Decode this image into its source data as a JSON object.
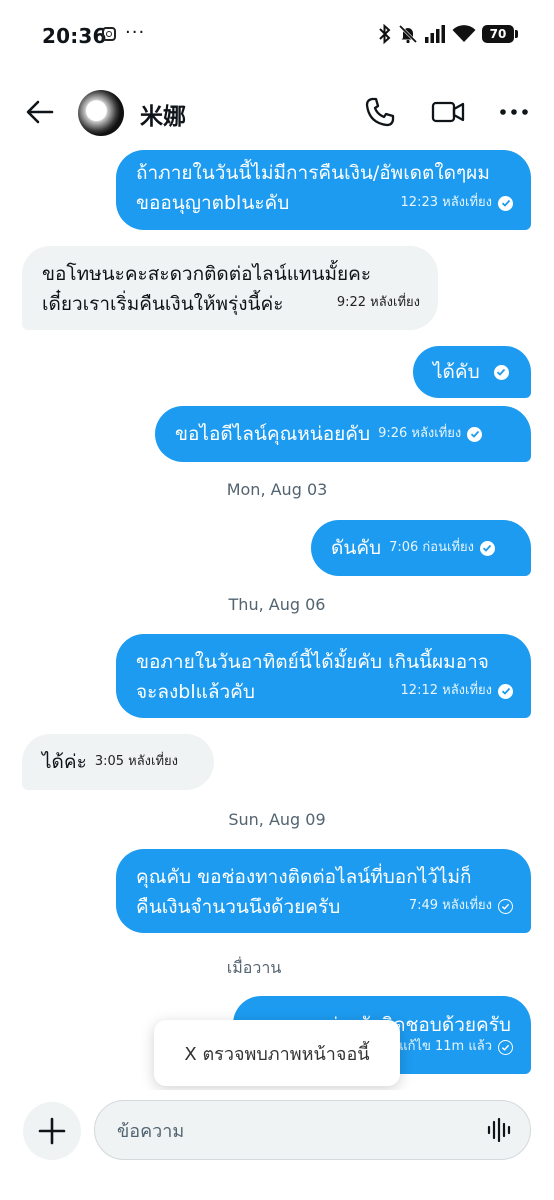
{
  "status_bar": {
    "time": "20:36",
    "dots": "···",
    "battery": "70"
  },
  "header": {
    "contact_name": "米娜"
  },
  "messages": [
    {
      "dir": "out",
      "lines": [
        "ถ้าภายในวันนี้ไม่มีการคืนเงิน/อัพเดตใดๆผม",
        "ขออนุญาตblนะคับ"
      ],
      "time": "12:23 หลังเที่ยง",
      "status": "read"
    },
    {
      "dir": "in",
      "lines": [
        "ขอโทษนะคะสะดวกติดต่อไลน์แทนมั้ยคะ",
        "เดี๋ยวเราเริ่มคืนเงินให้พรุ่งนี้ค่ะ"
      ],
      "time": "9:22 หลังเที่ยง"
    },
    {
      "dir": "out",
      "lines": [
        "ได้คับ"
      ],
      "time": "",
      "status": "read"
    },
    {
      "dir": "out",
      "lines": [
        "ขอไอดีไลน์คุณหน่อยคับ"
      ],
      "time": "9:26 หลังเที่ยง",
      "status": "read"
    },
    {
      "dir": "out",
      "lines": [
        "ดันคับ"
      ],
      "time": "7:06 ก่อนเที่ยง",
      "status": "read"
    },
    {
      "dir": "out",
      "lines": [
        "ขอภายในวันอาทิตย์นี้ได้มั้ยคับ เกินนี้ผมอาจ",
        "จะลงblแล้วคับ"
      ],
      "time": "12:12 หลังเที่ยง",
      "status": "read"
    },
    {
      "dir": "in",
      "lines": [
        "ได้ค่ะ"
      ],
      "time": "3:05 หลังเที่ยง"
    },
    {
      "dir": "out",
      "lines": [
        "คุณคับ ขอช่องทางติดต่อไลน์ที่บอกไว้ไม่ก็",
        "คืนเงินจำนวนนึงด้วยครับ"
      ],
      "time": "7:49 หลังเที่ยง",
      "status": "sent"
    },
    {
      "dir": "out",
      "lines": [
        "รบกวนช่วยรับผิดชอบด้วยครับ"
      ],
      "time": "แก้ไข 11m แล้ว",
      "status": "sent"
    }
  ],
  "date_separators": [
    "Mon, Aug 03",
    "Thu, Aug 06",
    "Sun, Aug 09",
    "เมื่อวาน"
  ],
  "toast": {
    "text": "X ตรวจพบภาพหน้าจอนี้"
  },
  "composer": {
    "placeholder": "ข้อความ"
  },
  "colors": {
    "accent": "#1d9bf0",
    "incoming_bubble": "#eff3f4"
  }
}
